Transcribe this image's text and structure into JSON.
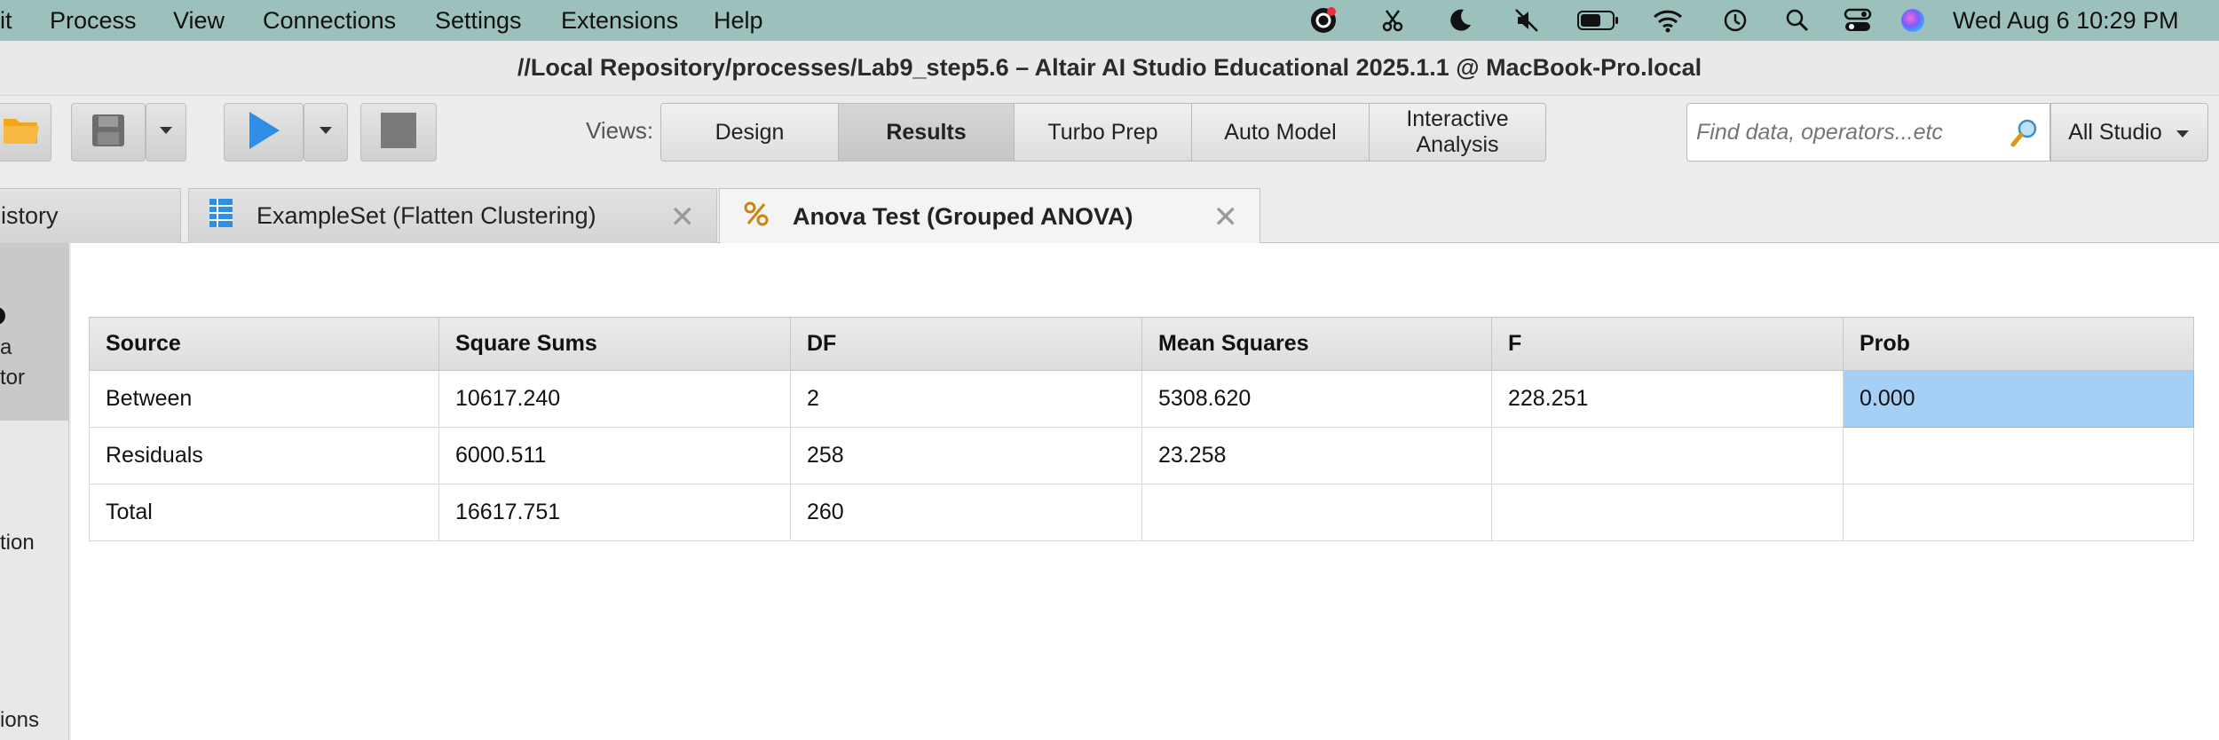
{
  "menubar": {
    "items": [
      "it",
      "Process",
      "View",
      "Connections",
      "Settings",
      "Extensions",
      "Help"
    ],
    "status_icons": [
      "grammarly-icon",
      "scissors-icon",
      "moon-icon",
      "mute-icon",
      "battery-icon",
      "wifi-icon",
      "time-machine-icon",
      "search-icon",
      "control-center-icon",
      "siri-icon"
    ],
    "clock": "Wed Aug 6  10:29 PM"
  },
  "window": {
    "title": "//Local Repository/processes/Lab9_step5.6 – Altair AI Studio Educational 2025.1.1 @ MacBook-Pro.local"
  },
  "toolbar": {
    "views_label": "Views:",
    "views": [
      {
        "label": "Design",
        "active": false
      },
      {
        "label": "Results",
        "active": true
      },
      {
        "label": "Turbo Prep",
        "active": false
      },
      {
        "label": "Auto Model",
        "active": false
      },
      {
        "label": "Interactive Analysis",
        "active": false
      }
    ],
    "search_placeholder": "Find data, operators...etc",
    "scope_label": "All Studio"
  },
  "tabs": [
    {
      "label": "istory",
      "active": false
    },
    {
      "label": "ExampleSet (Flatten Clustering)",
      "active": false
    },
    {
      "label": "Anova Test (Grouped ANOVA)",
      "active": true
    }
  ],
  "sidebar": {
    "labels": [
      "a",
      "tor",
      "tion",
      "ions"
    ]
  },
  "anova": {
    "headers": [
      "Source",
      "Square Sums",
      "DF",
      "Mean Squares",
      "F",
      "Prob"
    ],
    "rows": [
      [
        "Between",
        "10617.240",
        "2",
        "5308.620",
        "228.251",
        "0.000"
      ],
      [
        "Residuals",
        "6000.511",
        "258",
        "23.258",
        "",
        ""
      ],
      [
        "Total",
        "16617.751",
        "260",
        "",
        "",
        ""
      ]
    ]
  },
  "colors": {
    "menubar_bg": "#9cc0bc",
    "selected_cell": "#a6cff5",
    "run_button": "#2f8fe6",
    "folder": "#f4a51c"
  }
}
